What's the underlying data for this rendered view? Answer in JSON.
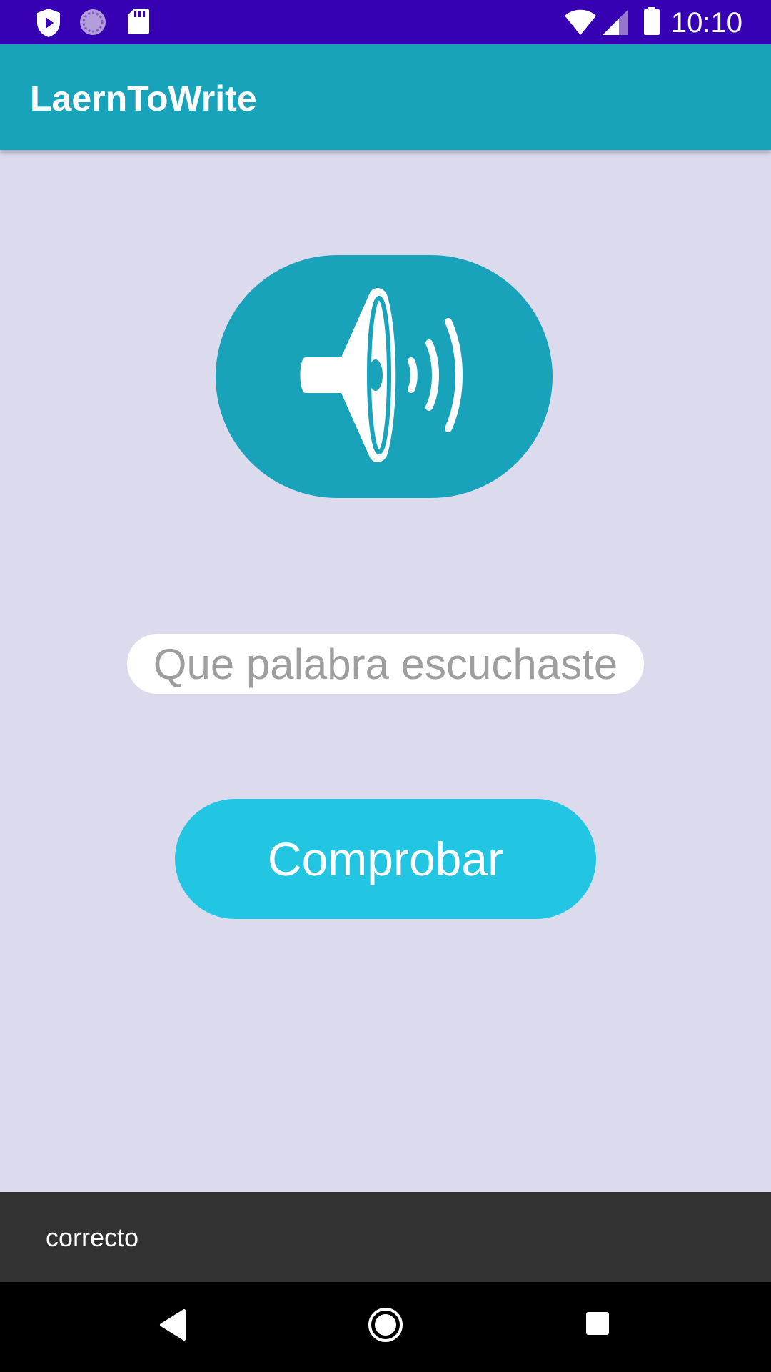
{
  "status_bar": {
    "time": "10:10",
    "left_icons": [
      "shield-play-icon",
      "sync-circle-icon",
      "sd-card-icon"
    ],
    "right_icons": [
      "wifi-icon",
      "cell-signal-icon",
      "battery-icon"
    ]
  },
  "app_bar": {
    "title": "LaernToWrite"
  },
  "main": {
    "speaker_icon": "speaker-volume-icon",
    "word_input": {
      "placeholder": "Que palabra escuchaste",
      "value": ""
    },
    "check_button_label": "Comprobar"
  },
  "snackbar": {
    "message": "correcto"
  },
  "nav_bar": {
    "buttons": [
      "back-icon",
      "home-icon",
      "recents-icon"
    ]
  },
  "colors": {
    "status_bar": "#3700b3",
    "app_bar": "#19a3ba",
    "background": "#dcdbee",
    "speaker_button": "#19a3ba",
    "check_button": "#22c6e3",
    "snackbar": "#323232",
    "nav_bar": "#000000"
  }
}
